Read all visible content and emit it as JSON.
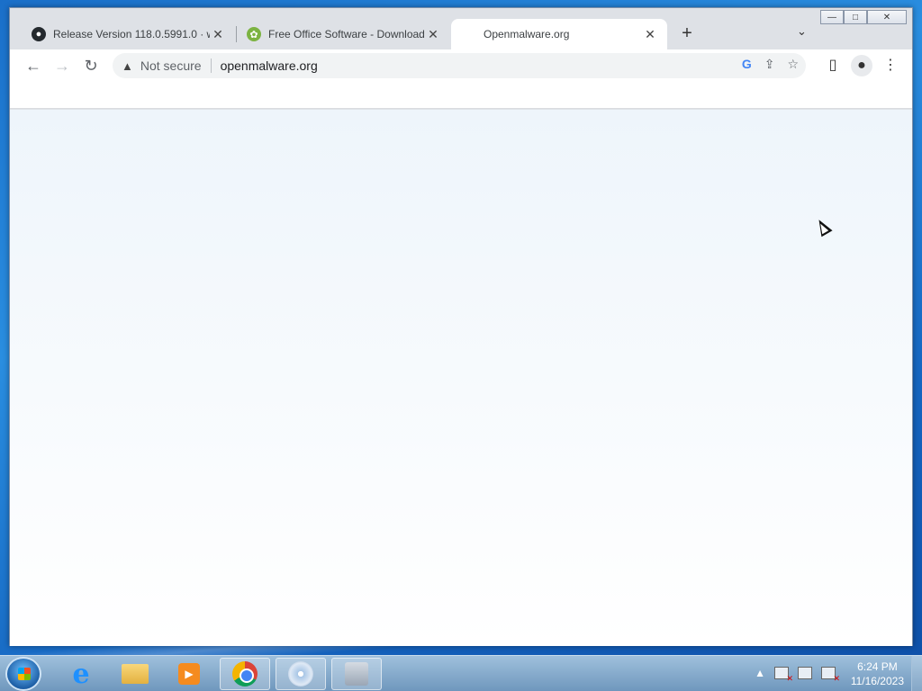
{
  "browser": {
    "tabs": [
      {
        "label": "Release Version 118.0.5991.0 · w",
        "favicon": "github-icon",
        "active": false
      },
      {
        "label": "Free Office Software - Download",
        "favicon": "office-leaf-icon",
        "active": false
      },
      {
        "label": "Openmalware.org",
        "favicon": "",
        "active": true
      }
    ],
    "new_tab": "+",
    "tab_menu": "⌄",
    "window_controls": {
      "minimize": "—",
      "maximize": "□",
      "close": "✕"
    },
    "toolbar": {
      "back": "←",
      "forward": "→",
      "reload": "↻",
      "security_label": "Not secure",
      "url": "openmalware.org"
    },
    "icons": [
      "google-icon",
      "share-icon",
      "bookmark-star-icon",
      "side-panel-icon",
      "profile-icon",
      "menu-icon"
    ]
  },
  "taskbar": {
    "apps": [
      "start-button",
      "internet-explorer",
      "file-explorer",
      "media-player",
      "chrome",
      "disc-utility",
      "package-utility"
    ],
    "clock": {
      "time": "6:24 PM",
      "date": "11/16/2023"
    },
    "tray_arrow": "▲"
  },
  "colors": {
    "accent": "#1a73e8",
    "desktop": "#1a6fc9",
    "taskbar": "#8fb3d4"
  }
}
